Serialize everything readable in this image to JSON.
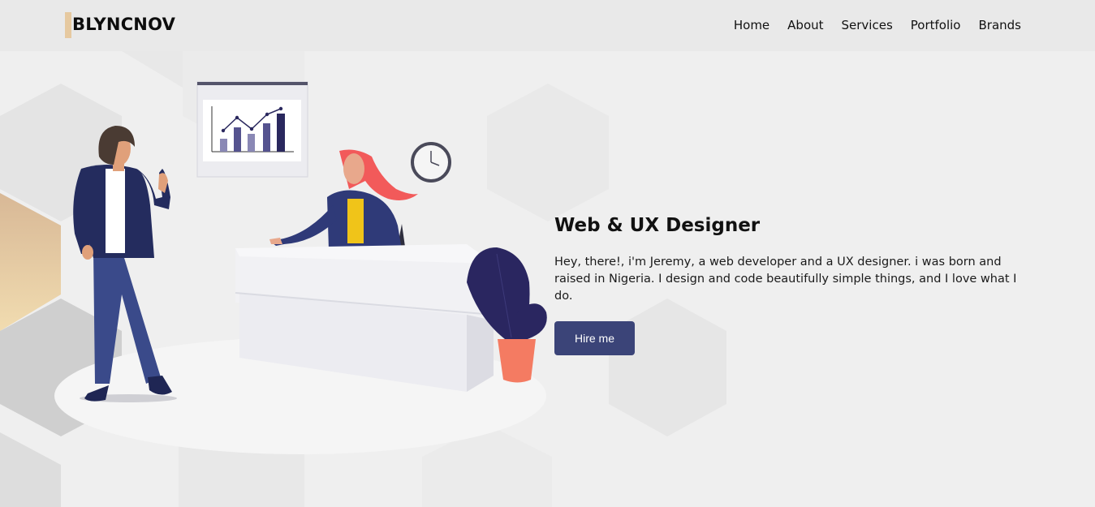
{
  "brand": {
    "name": "BLYNCNOV"
  },
  "nav": {
    "items": [
      {
        "label": "Home"
      },
      {
        "label": "About"
      },
      {
        "label": "Services"
      },
      {
        "label": "Portfolio"
      },
      {
        "label": "Brands"
      }
    ]
  },
  "hero": {
    "title": "Web & UX Designer",
    "description": "Hey, there!, i'm Jeremy, a web developer and a UX designer. i was born and raised in Nigeria. I design and code beautifully simple things, and I love what I do.",
    "cta_label": "Hire me",
    "accent_color": "#3b4478",
    "brand_accent": "#e6c9a0"
  },
  "illustration": {
    "icons": [
      "presentation-board-icon",
      "clock-icon",
      "plant-icon"
    ]
  }
}
